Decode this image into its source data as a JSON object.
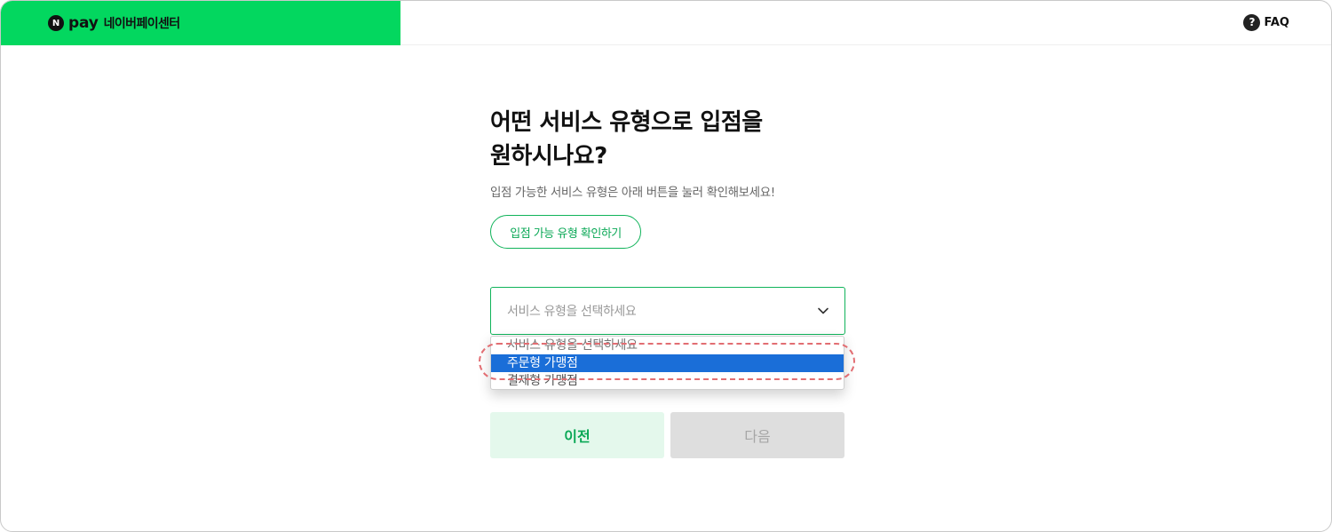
{
  "header": {
    "brand_badge": "N",
    "brand_pay": "pay",
    "brand_center": "네이버페이센터",
    "faq_icon": "?",
    "faq_label": "FAQ"
  },
  "main": {
    "title_line1": "어떤 서비스 유형으로 입점을",
    "title_line2": "원하시나요?",
    "subtitle": "입점 가능한 서비스 유형은 아래 버튼을 눌러 확인해보세요!",
    "check_button_label": "입점 가능 유형 확인하기",
    "select_placeholder": "서비스 유형을 선택하세요"
  },
  "dropdown": {
    "options": [
      "서비스 유형을 선택하세요",
      "주문형 가맹점",
      "결제형 가맹점"
    ],
    "selected_index": 1
  },
  "buttons": {
    "prev_label": "이전",
    "next_label": "다음"
  },
  "colors": {
    "brand_green": "#03d75f",
    "accent_green": "#10b35a",
    "selected_option": "#1a6ed8",
    "highlight_ring": "#e26d72"
  },
  "icons": [
    "question-icon",
    "chevron-down-icon"
  ]
}
